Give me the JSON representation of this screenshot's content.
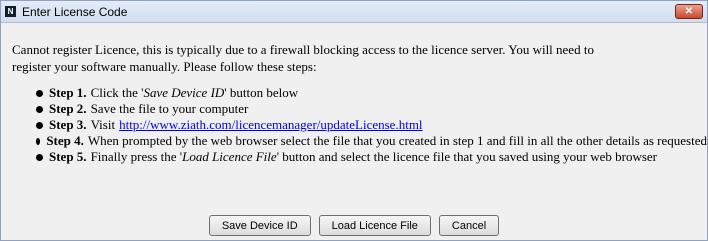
{
  "window": {
    "title": "Enter License Code",
    "close_symbol": "✕"
  },
  "intro": {
    "line1": "Cannot register Licence, this is typically due to a firewall blocking access to the licence server. You will need to",
    "line2": "register your software manually. Please follow these steps:"
  },
  "steps": [
    {
      "label": "Step 1.",
      "text_before": "Click the '",
      "emphasis": "Save Device ID",
      "text_after": "' button below"
    },
    {
      "label": "Step 2.",
      "text": "Save the file to your computer"
    },
    {
      "label": "Step 3.",
      "text": "Visit",
      "link": "http://www.ziath.com/licencemanager/updateLicense.html"
    },
    {
      "label": "Step 4.",
      "text": "When prompted by the web browser select the file that you created in step 1 and fill in all the other details as requested"
    },
    {
      "label": "Step 5.",
      "text_before": "Finally press the '",
      "emphasis": "Load Licence File",
      "text_after": "' button and select the licence file that you saved using your web browser"
    }
  ],
  "buttons": {
    "save": "Save Device ID",
    "load": "Load Licence File",
    "cancel": "Cancel"
  }
}
